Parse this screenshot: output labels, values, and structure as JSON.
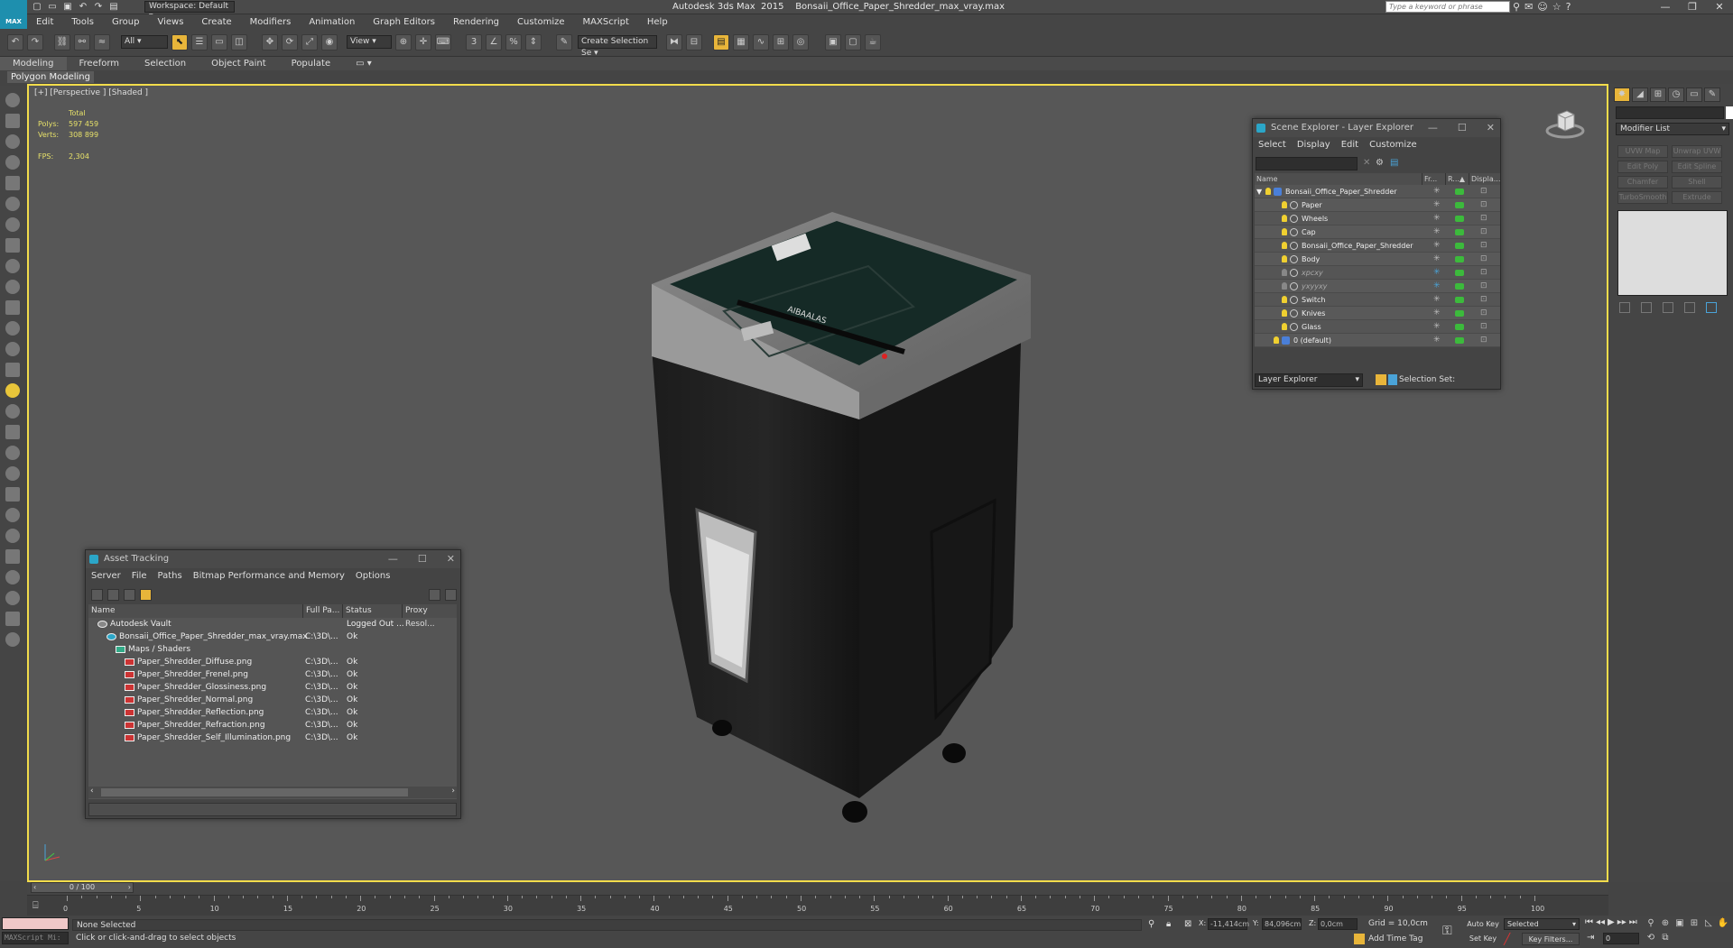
{
  "app": {
    "logo_text": "MAX",
    "window_title": "Autodesk 3ds Max  2015    Bonsaii_Office_Paper_Shredder_max_vray.max",
    "workspace": "Workspace: Default",
    "search_placeholder": "Type a keyword or phrase"
  },
  "menu": [
    "Edit",
    "Tools",
    "Group",
    "Views",
    "Create",
    "Modifiers",
    "Animation",
    "Graph Editors",
    "Rendering",
    "Customize",
    "MAXScript",
    "Help"
  ],
  "toolbar": {
    "selection_filter": "All",
    "ref_coord": "View",
    "named_selection": "Create Selection Se"
  },
  "ribbon": {
    "tabs": [
      "Modeling",
      "Freeform",
      "Selection",
      "Object Paint",
      "Populate"
    ],
    "active_tab": "Modeling",
    "sub_label": "Polygon Modeling"
  },
  "viewport": {
    "label": "[+] [Perspective ] [Shaded ]",
    "stats_header": "Total",
    "polys_label": "Polys:",
    "polys_value": "597 459",
    "verts_label": "Verts:",
    "verts_value": "308 899",
    "fps_label": "FPS:",
    "fps_value": "2,304",
    "shredder_label": "AIBAALAS"
  },
  "command_panel": {
    "modifier_list": "Modifier List",
    "buttons": [
      "UVW Map",
      "Unwrap UVW",
      "Edit Poly",
      "Edit Spline",
      "Chamfer",
      "Shell",
      "TurboSmooth",
      "Extrude"
    ]
  },
  "scene_explorer": {
    "title": "Scene Explorer - Layer Explorer",
    "menu": [
      "Select",
      "Display",
      "Edit",
      "Customize"
    ],
    "columns": [
      "Name",
      "Fr...",
      "R...▲",
      "Displa..."
    ],
    "rows": [
      {
        "name": "Bonsaii_Office_Paper_Shredder",
        "indent": 0
      },
      {
        "name": "Paper",
        "indent": 2
      },
      {
        "name": "Wheels",
        "indent": 2
      },
      {
        "name": "Cap",
        "indent": 2
      },
      {
        "name": "Bonsaii_Office_Paper_Shredder",
        "indent": 2
      },
      {
        "name": "Body",
        "indent": 2
      },
      {
        "name": "хрсху",
        "indent": 2
      },
      {
        "name": "ухууху",
        "indent": 2
      },
      {
        "name": "Switch",
        "indent": 2
      },
      {
        "name": "Knives",
        "indent": 2
      },
      {
        "name": "Glass",
        "indent": 2
      },
      {
        "name": "0 (default)",
        "indent": 1
      }
    ],
    "layer_dropdown": "Layer Explorer",
    "selection_set": "Selection Set:"
  },
  "asset_tracking": {
    "title": "Asset Tracking",
    "menu": [
      "Server",
      "File",
      "Paths",
      "Bitmap Performance and Memory",
      "Options"
    ],
    "columns": [
      "Name",
      "Full Pa...",
      "Status",
      "Proxy Resol..."
    ],
    "rows": [
      {
        "name": "Autodesk Vault",
        "path": "",
        "status": "Logged Out ...",
        "indent": 1,
        "icon": "vault-icon"
      },
      {
        "name": "Bonsaii_Office_Paper_Shredder_max_vray.max",
        "path": "C:\\3D\\...",
        "status": "Ok",
        "indent": 2,
        "icon": "max-file-icon"
      },
      {
        "name": "Maps / Shaders",
        "path": "",
        "status": "",
        "indent": 3,
        "icon": "maps-folder-icon"
      },
      {
        "name": "Paper_Shredder_Diffuse.png",
        "path": "C:\\3D\\...",
        "status": "Ok",
        "indent": 4,
        "icon": "bitmap-icon"
      },
      {
        "name": "Paper_Shredder_Frenel.png",
        "path": "C:\\3D\\...",
        "status": "Ok",
        "indent": 4,
        "icon": "bitmap-icon"
      },
      {
        "name": "Paper_Shredder_Glossiness.png",
        "path": "C:\\3D\\...",
        "status": "Ok",
        "indent": 4,
        "icon": "bitmap-icon"
      },
      {
        "name": "Paper_Shredder_Normal.png",
        "path": "C:\\3D\\...",
        "status": "Ok",
        "indent": 4,
        "icon": "bitmap-icon"
      },
      {
        "name": "Paper_Shredder_Reflection.png",
        "path": "C:\\3D\\...",
        "status": "Ok",
        "indent": 4,
        "icon": "bitmap-icon"
      },
      {
        "name": "Paper_Shredder_Refraction.png",
        "path": "C:\\3D\\...",
        "status": "Ok",
        "indent": 4,
        "icon": "bitmap-icon"
      },
      {
        "name": "Paper_Shredder_Self_Illumination.png",
        "path": "C:\\3D\\...",
        "status": "Ok",
        "indent": 4,
        "icon": "bitmap-icon"
      }
    ]
  },
  "timeline": {
    "slider_label": "0 / 100",
    "ticks": [
      "0",
      "5",
      "10",
      "15",
      "20",
      "25",
      "30",
      "35",
      "40",
      "45",
      "50",
      "55",
      "60",
      "65",
      "70",
      "75",
      "80",
      "85",
      "90",
      "95",
      "100"
    ]
  },
  "status": {
    "maxscript_placeholder": "MAXScript Mi:",
    "selection": "None Selected",
    "prompt": "Click or click-and-drag to select objects",
    "x_label": "X:",
    "x_value": "-11,414cm",
    "y_label": "Y:",
    "y_value": "84,096cm",
    "z_label": "Z:",
    "z_value": "0,0cm",
    "grid": "Grid = 10,0cm",
    "add_time_tag": "Add Time Tag",
    "auto_key": "Auto Key",
    "set_key": "Set Key",
    "selected_dropdown": "Selected",
    "key_filters": "Key Filters...",
    "frame": "0"
  },
  "colors": {
    "viewport_border": "#f2dc4b",
    "accent": "#2ba6c8",
    "stats_text": "#e6e06a"
  }
}
